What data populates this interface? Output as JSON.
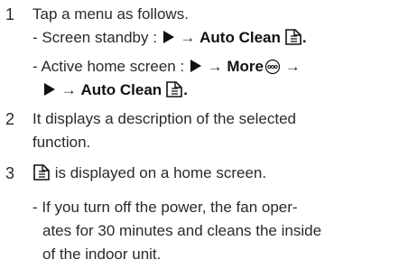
{
  "steps": [
    {
      "number": "1",
      "text": "Tap a menu as follows.",
      "line_a_prefix": "- Screen standby : ",
      "line_a_arrow": " → ",
      "line_a_target": "Auto Clean",
      "line_a_end": ".",
      "line_b_prefix": "- Active home screen : ",
      "line_b_arrow": " → ",
      "line_b_more": "More",
      "line_b_arrow2": " →",
      "line_c_arrow": " → ",
      "line_c_target": "Auto Clean",
      "line_c_end": "."
    },
    {
      "number": "2",
      "line_1": "It displays a description of the selected",
      "line_2": "function."
    },
    {
      "number": "3",
      "text": " is displayed on a home screen.",
      "note_line_1": "- If you turn off the power, the fan oper-",
      "note_line_2": "ates for 30 minutes and cleans the inside",
      "note_line_3": "of the indoor unit."
    }
  ],
  "icons": {
    "play": "play-triangle-icon",
    "auto_clean": "auto-clean-icon",
    "more": "more-icon"
  },
  "colors": {
    "text": "#2a2a2a",
    "emphasis": "#111111"
  }
}
